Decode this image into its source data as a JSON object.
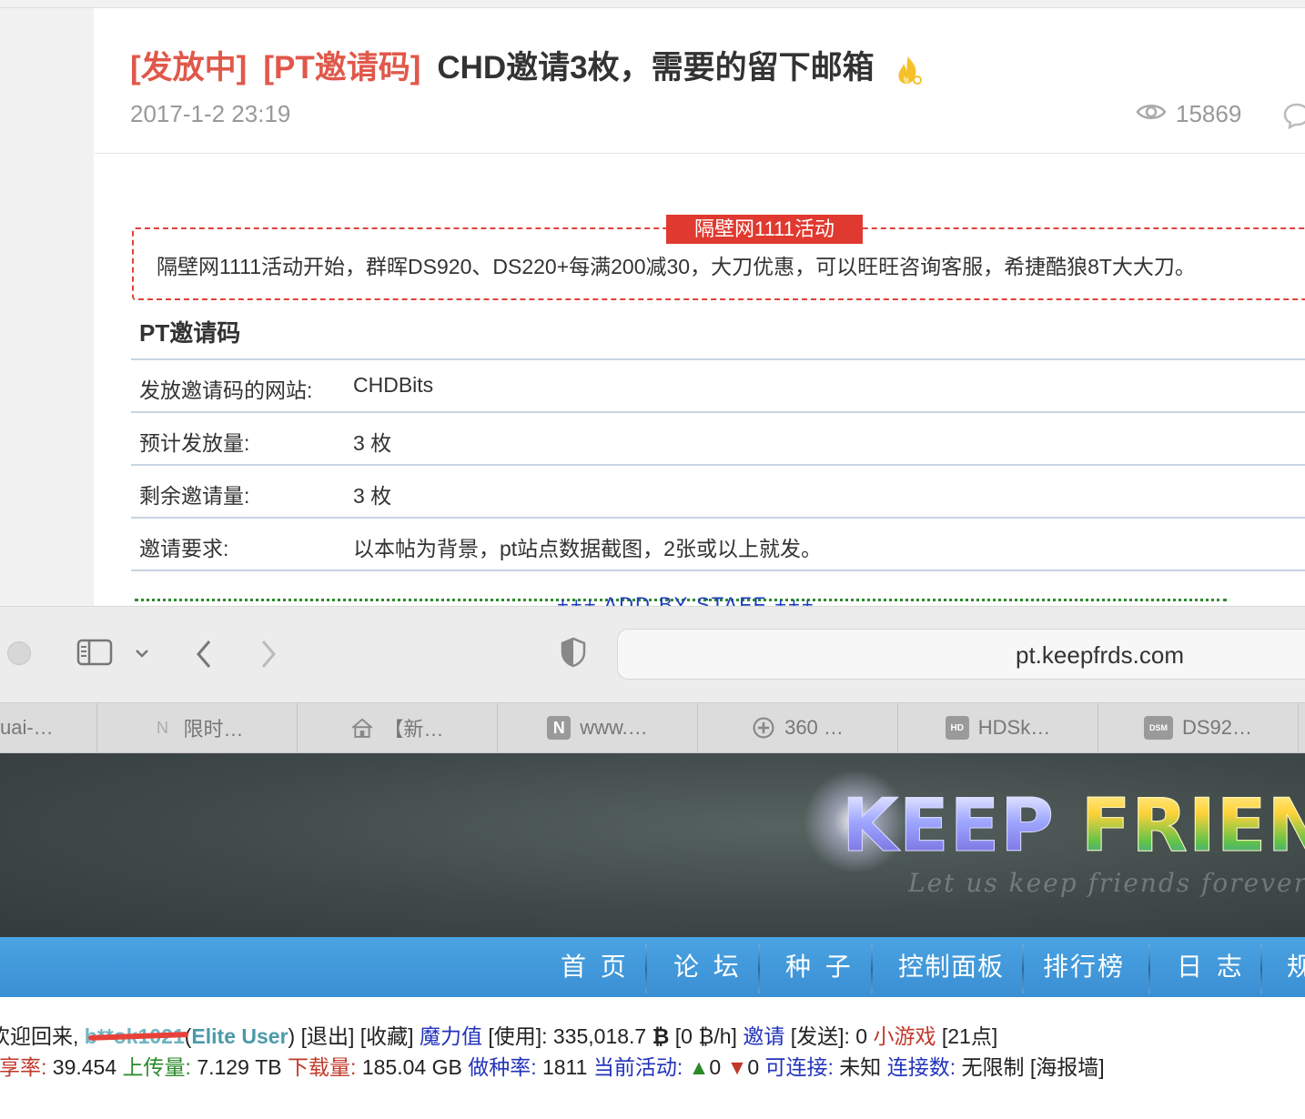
{
  "post": {
    "tag1": "[发放中]",
    "tag2": "[PT邀请码]",
    "title": "CHD邀请3枚，需要的留下邮箱",
    "date": "2017-1-2 23:19",
    "views": "15869"
  },
  "promo": {
    "badge": "隔壁网1111活动",
    "text": "隔壁网1111活动开始，群晖DS920、DS220+每满200减30，大刀优惠，可以旺旺咨询客服，希捷酷狼8T大大刀。"
  },
  "invite_table": {
    "heading": "PT邀请码",
    "rows": [
      {
        "key": "发放邀请码的网站:",
        "value": "CHDBits"
      },
      {
        "key": "预计发放量:",
        "value": "3 枚"
      },
      {
        "key": "剩余邀请量:",
        "value": "3 枚"
      },
      {
        "key": "邀请要求:",
        "value": "以本帖为背景，pt站点数据截图，2张或以上就发。"
      }
    ]
  },
  "staff_note": "+++ ADD BY STAFF +++",
  "browser": {
    "url": "pt.keepfrds.com",
    "tabs": [
      {
        "label": "uai-…",
        "icon": ""
      },
      {
        "label": "限时…",
        "icon": "N"
      },
      {
        "label": "【新…",
        "icon": "home"
      },
      {
        "label": "www.…",
        "icon": "N"
      },
      {
        "label": "360 …",
        "icon": "plus"
      },
      {
        "label": "HDSk…",
        "icon": "HD"
      },
      {
        "label": "DS92…",
        "icon": "DSM"
      }
    ]
  },
  "site": {
    "logo_k": "KEEP",
    "logo_f": "FRIENDS",
    "slogan": "Let us keep friends forever!",
    "nav": [
      "首 页",
      "论 坛",
      "种 子",
      "控制面板",
      "排行榜",
      "日 志",
      "规"
    ]
  },
  "user": {
    "welcome": "欢迎回来,",
    "username": "b**ok1021",
    "class": "Elite User",
    "logout": "[退出]",
    "favorites": "[收藏]",
    "magic_label": "魔力值",
    "magic_use": "[使用]:",
    "magic_value": "335,018.7",
    "magic_rate": "[0 ₿/h]",
    "invite_label": "邀请",
    "invite_send": "[发送]:",
    "invite_count": "0",
    "game_label": "小游戏",
    "game_points": "[21点]",
    "ratio_label": "分享率:",
    "ratio": "39.454",
    "upload_label": "上传量:",
    "upload": "7.129 TB",
    "download_label": "下载量:",
    "download": "185.04 GB",
    "seed_label": "做种率:",
    "seed": "1811",
    "activity_label": "当前活动:",
    "seeding": "0",
    "leeching": "0",
    "connectable_label": "可连接:",
    "connectable": "未知",
    "connections_label": "连接数:",
    "connections": "无限制",
    "poster_wall": "[海报墙]"
  },
  "colors": {
    "tag_red": "#e0584a",
    "promo_red": "#e0392f",
    "nav_blue": "#3a8fd3",
    "link_blue": "#2233bb"
  }
}
